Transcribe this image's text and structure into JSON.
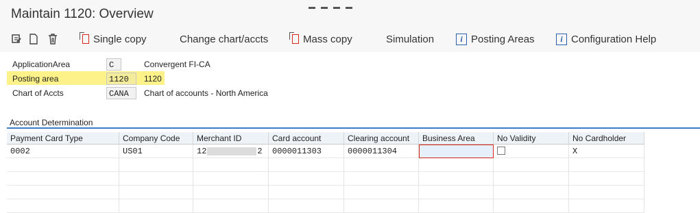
{
  "window": {
    "title": "Maintain 1120: Overview"
  },
  "toolbar": {
    "single_copy": "Single copy",
    "change_chart": "Change chart/accts",
    "mass_copy": "Mass copy",
    "simulation": "Simulation",
    "posting_areas": "Posting Areas",
    "configuration_help": "Configuration Help"
  },
  "header_fields": {
    "application_area": {
      "label": "ApplicationArea",
      "value": "C",
      "desc": "Convergent FI-CA"
    },
    "posting_area": {
      "label": "Posting area",
      "value": "1120",
      "desc": "1120"
    },
    "chart_of_accts": {
      "label": "Chart of Accts",
      "value": "CANA",
      "desc": "Chart of accounts - North America"
    }
  },
  "section": {
    "title": "Account Determination"
  },
  "table": {
    "columns": [
      "Payment Card Type",
      "Company Code",
      "Merchant ID",
      "Card account",
      "Clearing account",
      "Business Area",
      "No Validity",
      "No Cardholder"
    ],
    "rows": [
      {
        "payment_card_type": "0002",
        "company_code": "US01",
        "merchant_id_prefix": "12",
        "merchant_id_suffix": "2",
        "card_account": "0000011303",
        "clearing_account": "0000011304",
        "business_area": "",
        "no_validity": "",
        "no_cardholder": "X"
      }
    ]
  },
  "colors": {
    "highlight": "#fdf28a",
    "section_line": "#3b7bc4",
    "focus_border": "#d9261c"
  }
}
